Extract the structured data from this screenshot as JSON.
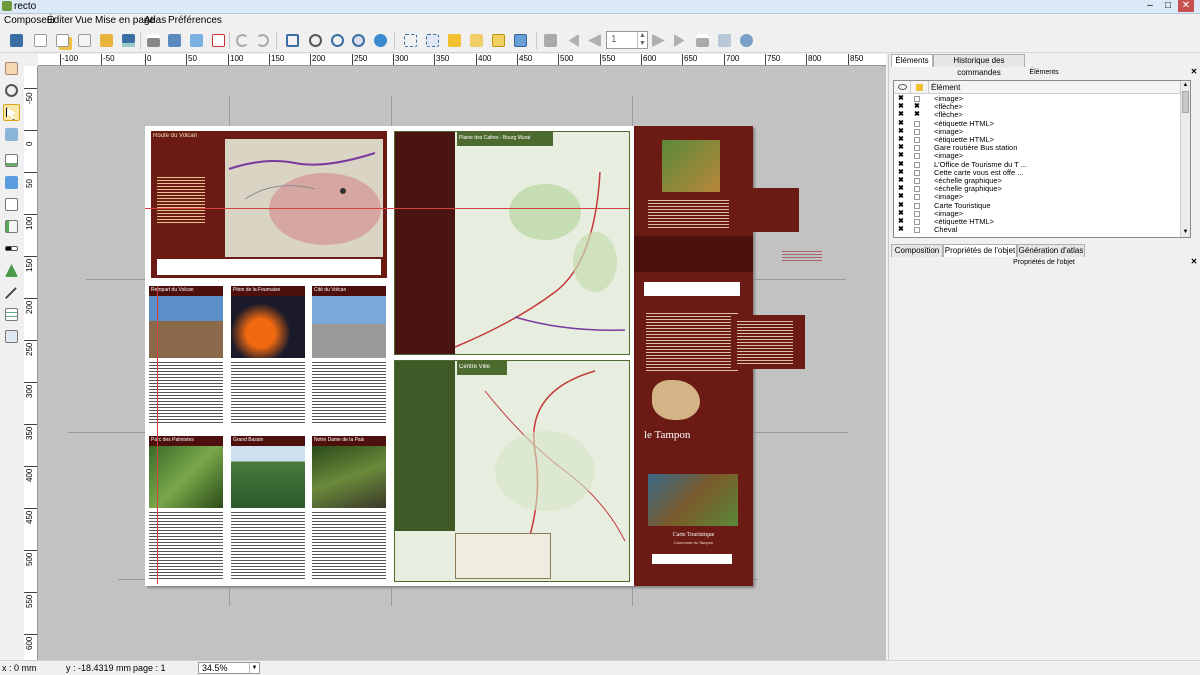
{
  "window": {
    "title": "recto"
  },
  "menu": [
    "Composeur",
    "Éditer",
    "Vue",
    "Mise en page",
    "Atlas",
    "Préférences"
  ],
  "toolbar": {
    "page_value": "1"
  },
  "ruler_h": [
    "-100",
    "-50",
    "0",
    "50",
    "100",
    "150",
    "200",
    "250",
    "300",
    "350",
    "400",
    "450",
    "500",
    "550",
    "600",
    "650",
    "700",
    "750",
    "800",
    "850"
  ],
  "ruler_v": [
    "-50",
    "0",
    "50",
    "100",
    "150",
    "200",
    "250",
    "300",
    "350",
    "400",
    "450",
    "500",
    "550",
    "600"
  ],
  "map_sheet": {
    "titles": {
      "volcano_route": "Route du Volcan",
      "plaine_des_cafres": "Plaine des Cafres - Bourg Murat",
      "centre_ville": "Centre Ville",
      "le_tampon": "le Tampon",
      "carte_touristique": "Carte Touristique",
      "commune": "Commune du Tampon"
    },
    "photo_panels": [
      "Rempart du Volcan",
      "Piton de la Fournaise",
      "Cité du Volcan",
      "Parc des Palmistes",
      "Grand Bassin",
      "Notre Dame de la Paix"
    ]
  },
  "dock": {
    "tabs_top": [
      "Éléments",
      "Historique des commandes"
    ],
    "elements_header": "Éléments",
    "column_label": "Élément",
    "items": [
      "<image>",
      "<flèche>",
      "<flèche>",
      "<étiquette HTML>",
      "<image>",
      "<étiquette HTML>",
      "Gare routière Bus station",
      "<image>",
      "L'Office de Tourisme du T ...",
      "Cette carte vous est offe ...",
      "<échelle graphique>",
      "<échelle graphique>",
      "<image>",
      "Carte Touristique",
      "<image>",
      "<étiquette HTML>",
      "Cheval"
    ],
    "tabs_bottom": [
      "Composition",
      "Propriétés de l'objet",
      "Génération d'atlas"
    ],
    "props_header": "Propriétés de l'objet"
  },
  "status": {
    "x": "x : 0 mm",
    "y": "y : -18.4319 mm",
    "page": "page : 1",
    "zoom": "34.5%"
  },
  "colors": {
    "map_brown": "#6b1a14",
    "map_green": "#4d6b2f",
    "selection": "#fbe8a8"
  }
}
